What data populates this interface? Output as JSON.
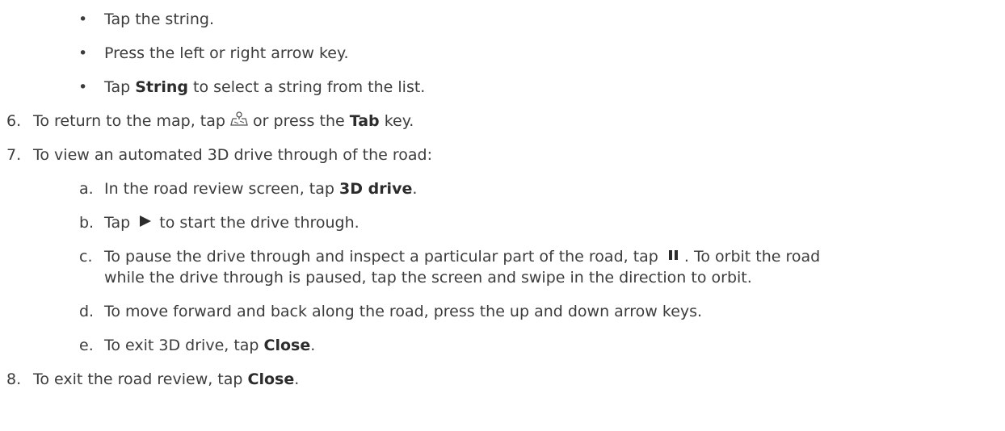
{
  "bullets": [
    {
      "text": "Tap the string."
    },
    {
      "text": "Press the left or right arrow key."
    },
    {
      "pre": "Tap ",
      "bold": "String",
      "post": " to select a string from the list."
    }
  ],
  "steps": {
    "s6": {
      "num": "6.",
      "pre": "To return to the map, tap ",
      "mid": " or press the ",
      "bold": "Tab",
      "post": " key.",
      "icon": "map-icon"
    },
    "s7": {
      "num": "7.",
      "text": "To view an automated 3D drive through of the road:"
    },
    "s8": {
      "num": "8.",
      "pre": "To exit the road review, tap ",
      "bold": "Close",
      "post": "."
    }
  },
  "substeps": {
    "a": {
      "mark": "a.",
      "pre": "In the road review screen, tap ",
      "bold": "3D drive",
      "post": "."
    },
    "b": {
      "mark": "b.",
      "pre": "Tap ",
      "post": " to start the drive through.",
      "icon": "play-icon"
    },
    "c": {
      "mark": "c.",
      "pre": "To pause the drive through and inspect a particular part of the road, tap ",
      "post": ". To orbit the road",
      "line2": "while the drive through is paused, tap the screen and swipe in the direction to orbit.",
      "icon": "pause-icon"
    },
    "d": {
      "mark": "d.",
      "text": "To move forward and back along the road, press the up and down arrow keys."
    },
    "e": {
      "mark": "e.",
      "pre": "To exit 3D drive, tap ",
      "bold": "Close",
      "post": "."
    }
  }
}
